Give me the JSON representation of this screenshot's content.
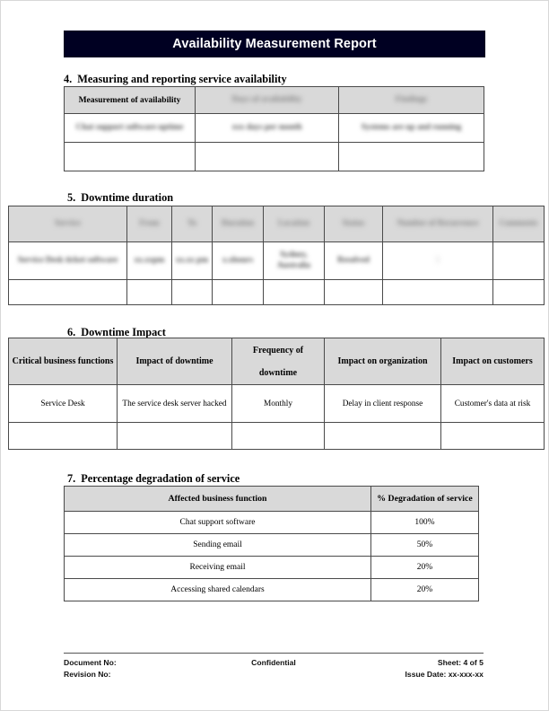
{
  "document": {
    "title": "Availability Measurement Report",
    "banner_color": "#000022"
  },
  "sections": {
    "s4": {
      "number": "4.",
      "heading": "Measuring and reporting service availability"
    },
    "s5": {
      "number": "5.",
      "heading": "Downtime duration"
    },
    "s6": {
      "number": "6.",
      "heading": "Downtime Impact"
    },
    "s7": {
      "number": "7.",
      "heading": "Percentage degradation of service"
    }
  },
  "table4": {
    "headers": [
      "Measurement of availability",
      "Days of availability",
      "Findings"
    ],
    "headers_redacted": [
      false,
      true,
      true
    ],
    "rows": [
      {
        "cells": [
          "Chat support software uptime",
          "xxx days per month",
          "Systems are up and running"
        ],
        "redacted": [
          true,
          true,
          true
        ]
      },
      {
        "cells": [
          "",
          "",
          ""
        ],
        "redacted": [
          false,
          false,
          false
        ]
      }
    ]
  },
  "table5": {
    "headers": [
      "Service",
      "From",
      "To",
      "Duration",
      "Location",
      "Status",
      "Number of Recurrence",
      "Comments"
    ],
    "headers_redacted": [
      true,
      true,
      true,
      true,
      true,
      true,
      true,
      true
    ],
    "rows": [
      {
        "cells": [
          "Service Desk ticket software",
          "xx.xxpm",
          "xx.xx pm",
          "x.xhours",
          "Sydney, Australia",
          "Resolved",
          "1",
          ""
        ],
        "redacted": [
          true,
          true,
          true,
          true,
          true,
          true,
          true,
          false
        ]
      },
      {
        "cells": [
          "",
          "",
          "",
          "",
          "",
          "",
          "",
          ""
        ],
        "redacted": [
          false,
          false,
          false,
          false,
          false,
          false,
          false,
          false
        ]
      }
    ]
  },
  "table6": {
    "headers": [
      "Critical business functions",
      "Impact of downtime",
      "Frequency of downtime",
      "Impact on organization",
      "Impact on customers"
    ],
    "header3_line1": "Frequency of",
    "header3_line2": "downtime",
    "rows": [
      {
        "cells": [
          "Service Desk",
          "The service desk server hacked",
          "Monthly",
          "Delay in client response",
          "Customer's data at risk"
        ]
      },
      {
        "cells": [
          "",
          "",
          "",
          "",
          ""
        ]
      }
    ]
  },
  "table7": {
    "headers": [
      "Affected business function",
      "% Degradation of service"
    ],
    "rows": [
      {
        "function": "Chat support software",
        "degradation": "100%"
      },
      {
        "function": "Sending email",
        "degradation": "50%"
      },
      {
        "function": "Receiving email",
        "degradation": "20%"
      },
      {
        "function": "Accessing shared calendars",
        "degradation": "20%"
      }
    ]
  },
  "footer": {
    "document_no_label": "Document No:",
    "revision_no_label": "Revision No:",
    "confidential": "Confidential",
    "sheet": "Sheet: 4 of 5",
    "issue_date": "Issue Date: xx-xxx-xx"
  }
}
